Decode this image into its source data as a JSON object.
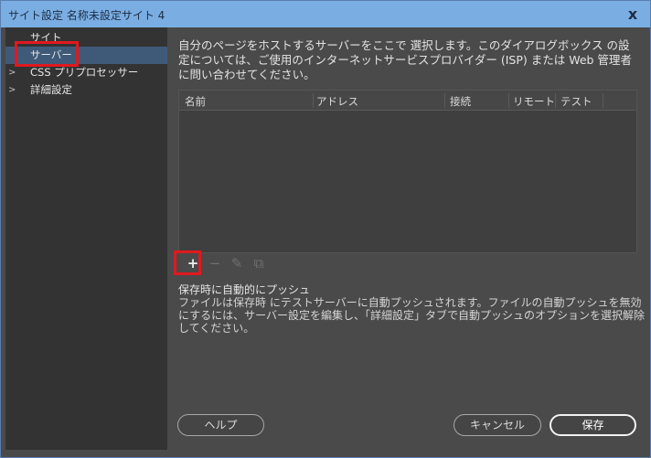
{
  "window": {
    "title": "サイト設定 名称未設定サイト 4",
    "close_label": "x"
  },
  "sidebar": {
    "items": [
      {
        "label": "サイト",
        "has_arrow": false
      },
      {
        "label": "サーバー",
        "has_arrow": false,
        "selected": true
      },
      {
        "label": "CSS プリプロセッサー",
        "has_arrow": true,
        "arrow": ">"
      },
      {
        "label": "詳細設定",
        "has_arrow": true,
        "arrow": ">"
      }
    ]
  },
  "main": {
    "description": "自分のページをホストするサーバーをここで 選択します。このダイアログボックス の設定については、ご使用のインターネットサービスプロバイダー (ISP) または Web 管理者に問い合わせてください。",
    "table": {
      "columns": [
        "名前",
        "アドレス",
        "接続",
        "リモート",
        "テスト"
      ],
      "rows": []
    },
    "toolbar": {
      "add_icon": "+",
      "remove_icon": "−",
      "edit_icon": "✎",
      "duplicate_icon": "⧉"
    },
    "push": {
      "title": "保存時に自動的にプッシュ",
      "description": "ファイルは保存時 にテストサーバーに自動プッシュされます。ファイルの自動プッシュを無効にするには、サーバー設定を編集し、「詳細設定」タブで自動プッシュのオプションを選択解除 してください。"
    }
  },
  "footer": {
    "help_label": "ヘルプ",
    "cancel_label": "キャンセル",
    "save_label": "保存"
  },
  "colors": {
    "titlebar": "#7aaee3",
    "selection": "#3f5a79",
    "highlight": "#e0191f"
  }
}
